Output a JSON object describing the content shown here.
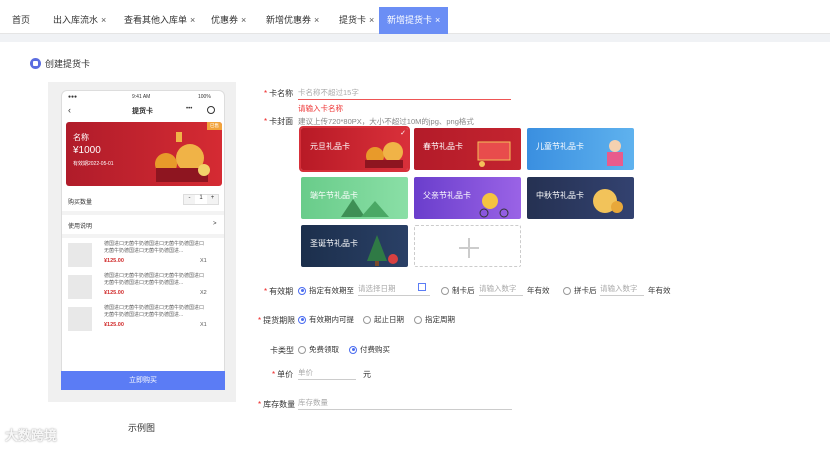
{
  "tabs": [
    {
      "label": "首页",
      "closable": false
    },
    {
      "label": "出入库流水",
      "closable": true
    },
    {
      "label": "查看其他入库单",
      "closable": true
    },
    {
      "label": "优惠券",
      "closable": true
    },
    {
      "label": "新增优惠券",
      "closable": true
    },
    {
      "label": "提货卡",
      "closable": true
    },
    {
      "label": "新增提货卡",
      "closable": true,
      "active": true
    }
  ],
  "close_glyph": "×",
  "section_title": "创建提货卡",
  "preview": {
    "status_time": "9:41 AM",
    "status_battery": "100%",
    "nav_title": "提货卡",
    "card": {
      "name_label": "名称",
      "amount": "¥1000",
      "validity": "有效期2022-05-01",
      "badge": "已售"
    },
    "purchase_qty_label": "购买数量",
    "qty_minus": "-",
    "qty_value": "1",
    "qty_plus": "+",
    "usage_label": "使用说明",
    "usage_arrow": ">",
    "items": [
      {
        "text": "德国进口无菌牛奶德国进口无菌牛奶德国进口无菌牛奶德国进口无菌牛奶德国进...",
        "price": "¥125.00",
        "qty": "X1"
      },
      {
        "text": "德国进口无菌牛奶德国进口无菌牛奶德国进口无菌牛奶德国进口无菌牛奶德国进...",
        "price": "¥125.00",
        "qty": "X2"
      },
      {
        "text": "德国进口无菌牛奶德国进口无菌牛奶德国进口无菌牛奶德国进口无菌牛奶德国进...",
        "price": "¥125.00",
        "qty": "X1"
      }
    ],
    "buy_button": "立即购买",
    "caption": "示例图"
  },
  "form": {
    "card_name": {
      "label": "卡名称",
      "placeholder": "卡名称不超过15字",
      "error": "请输入卡名称"
    },
    "card_cover": {
      "label": "卡封面",
      "hint": "建议上传720*80PX，大小不超过10M的jpg、png格式",
      "covers": [
        {
          "title": "元旦礼品卡",
          "color": "#c8232e",
          "selected": true
        },
        {
          "title": "春节礼品卡",
          "color": "#b91d2b",
          "selected": false
        },
        {
          "title": "儿童节礼品卡",
          "color": "#3f9ae0",
          "selected": false
        },
        {
          "title": "端午节礼品卡",
          "color": "#6fcf8d",
          "selected": false
        },
        {
          "title": "父亲节礼品卡",
          "color": "#7d45d6",
          "selected": false
        },
        {
          "title": "中秋节礼品卡",
          "color": "#2b3555",
          "selected": false
        },
        {
          "title": "圣诞节礼品卡",
          "color": "#1f3350",
          "selected": false
        }
      ]
    },
    "validity": {
      "label": "有效期",
      "opt1": "指定有效期至",
      "date_placeholder": "请选择日期",
      "opt2": "制卡后",
      "num_placeholder2": "请输入数字",
      "unit2": "年有效",
      "opt3": "拼卡后",
      "num_placeholder3": "请输入数字",
      "unit3": "年有效"
    },
    "pickup_period": {
      "label": "提货期限",
      "opt1": "有效期内可提",
      "opt2": "起止日期",
      "opt3": "指定周期"
    },
    "card_type": {
      "label": "卡类型",
      "opt1": "免费领取",
      "opt2": "付费购买"
    },
    "unit_price": {
      "label": "单价",
      "placeholder": "单价",
      "unit": "元"
    },
    "stock": {
      "label": "库存数量",
      "placeholder": "库存数量"
    }
  },
  "watermark": "大数跨境",
  "colors": {
    "accent": "#5b7cf5",
    "active_tab": "#6b8ef5",
    "error": "#e33333"
  }
}
